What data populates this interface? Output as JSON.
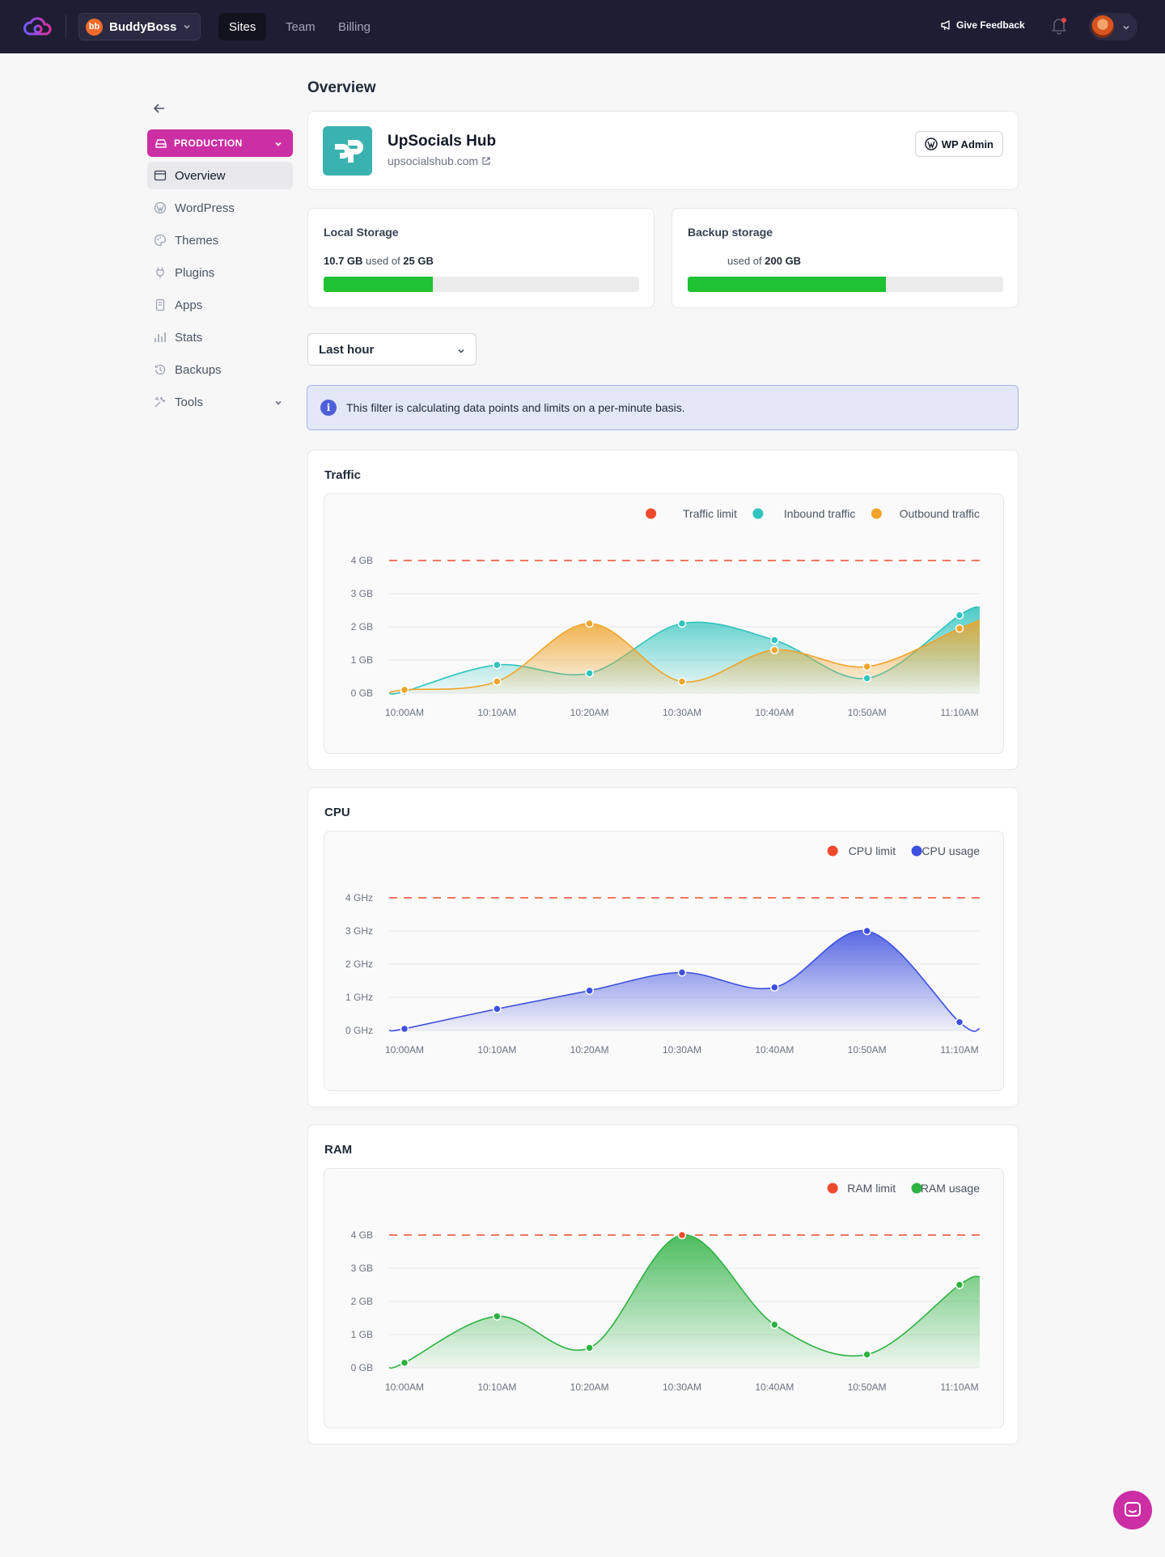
{
  "topbar": {
    "org_badge": "bb",
    "org_name": "BuddyBoss",
    "tabs": [
      "Sites",
      "Team",
      "Billing"
    ],
    "feedback_label": "Give Feedback",
    "colors": {
      "bg": "#1f1d33",
      "accent": "#cc2ea4"
    }
  },
  "sidebar": {
    "environment": "PRODUCTION",
    "items": [
      {
        "label": "Overview",
        "icon": "window-icon"
      },
      {
        "label": "WordPress",
        "icon": "wordpress-icon"
      },
      {
        "label": "Themes",
        "icon": "palette-icon"
      },
      {
        "label": "Plugins",
        "icon": "plug-icon"
      },
      {
        "label": "Apps",
        "icon": "app-icon"
      },
      {
        "label": "Stats",
        "icon": "bar-chart-icon"
      },
      {
        "label": "Backups",
        "icon": "history-icon"
      },
      {
        "label": "Tools",
        "icon": "tools-icon"
      }
    ]
  },
  "main": {
    "title": "Overview",
    "site": {
      "name": "UpSocials Hub",
      "url": "upsocialshub.com",
      "wp_admin_label": "WP Admin"
    },
    "storage": [
      {
        "title": "Local Storage",
        "used_value": "10.7 GB",
        "used_text": " used of ",
        "total": "25 GB",
        "fraction": 0.345
      },
      {
        "title": "Backup storage",
        "used_value": "",
        "used_text": "used of ",
        "total": "200 GB",
        "fraction": 0.627
      }
    ],
    "range_select": "Last hour",
    "info_banner": "This filter is calculating data points and limits on a per-minute basis."
  },
  "chart_data": [
    {
      "type": "area",
      "title": "Traffic",
      "x": [
        "10:00AM",
        "10:10AM",
        "10:20AM",
        "10:30AM",
        "10:40AM",
        "10:50AM",
        "11:10AM"
      ],
      "yticks": [
        "0 GB",
        "1 GB",
        "2 GB",
        "3 GB",
        "4 GB"
      ],
      "ylim": [
        0,
        4
      ],
      "limit": {
        "name": "Traffic limit",
        "value": 4,
        "color": "#ef4a2e"
      },
      "series": [
        {
          "name": "Inbound traffic",
          "color": "#2fc4be",
          "values": [
            0.05,
            0.85,
            0.6,
            2.1,
            1.6,
            0.45,
            2.35
          ]
        },
        {
          "name": "Outbound traffic",
          "color": "#f0a42a",
          "values": [
            0.1,
            0.35,
            2.1,
            0.35,
            1.3,
            0.8,
            1.95
          ]
        }
      ],
      "legend": "top-right",
      "grid": true
    },
    {
      "type": "area",
      "title": "CPU",
      "x": [
        "10:00AM",
        "10:10AM",
        "10:20AM",
        "10:30AM",
        "10:40AM",
        "10:50AM",
        "11:10AM"
      ],
      "yticks": [
        "0 GHz",
        "1 GHz",
        "2 GHz",
        "3 GHz",
        "4 GHz"
      ],
      "ylim": [
        0,
        4
      ],
      "limit": {
        "name": "CPU limit",
        "value": 4,
        "color": "#ef4a2e"
      },
      "series": [
        {
          "name": "CPU usage",
          "color": "#3d4fe0",
          "values": [
            0.05,
            0.65,
            1.2,
            1.75,
            1.3,
            3.0,
            0.25
          ]
        }
      ],
      "legend": "top-right",
      "grid": true
    },
    {
      "type": "area",
      "title": "RAM",
      "x": [
        "10:00AM",
        "10:10AM",
        "10:20AM",
        "10:30AM",
        "10:40AM",
        "10:50AM",
        "11:10AM"
      ],
      "yticks": [
        "0 GB",
        "1 GB",
        "2 GB",
        "3 GB",
        "4 GB"
      ],
      "ylim": [
        0,
        4
      ],
      "limit": {
        "name": "RAM limit",
        "value": 4,
        "color": "#ef4a2e"
      },
      "series": [
        {
          "name": "RAM usage",
          "color": "#2eb243",
          "values": [
            0.15,
            1.55,
            0.6,
            4.0,
            1.3,
            0.4,
            2.5
          ]
        }
      ],
      "legend": "top-right",
      "grid": true
    }
  ]
}
